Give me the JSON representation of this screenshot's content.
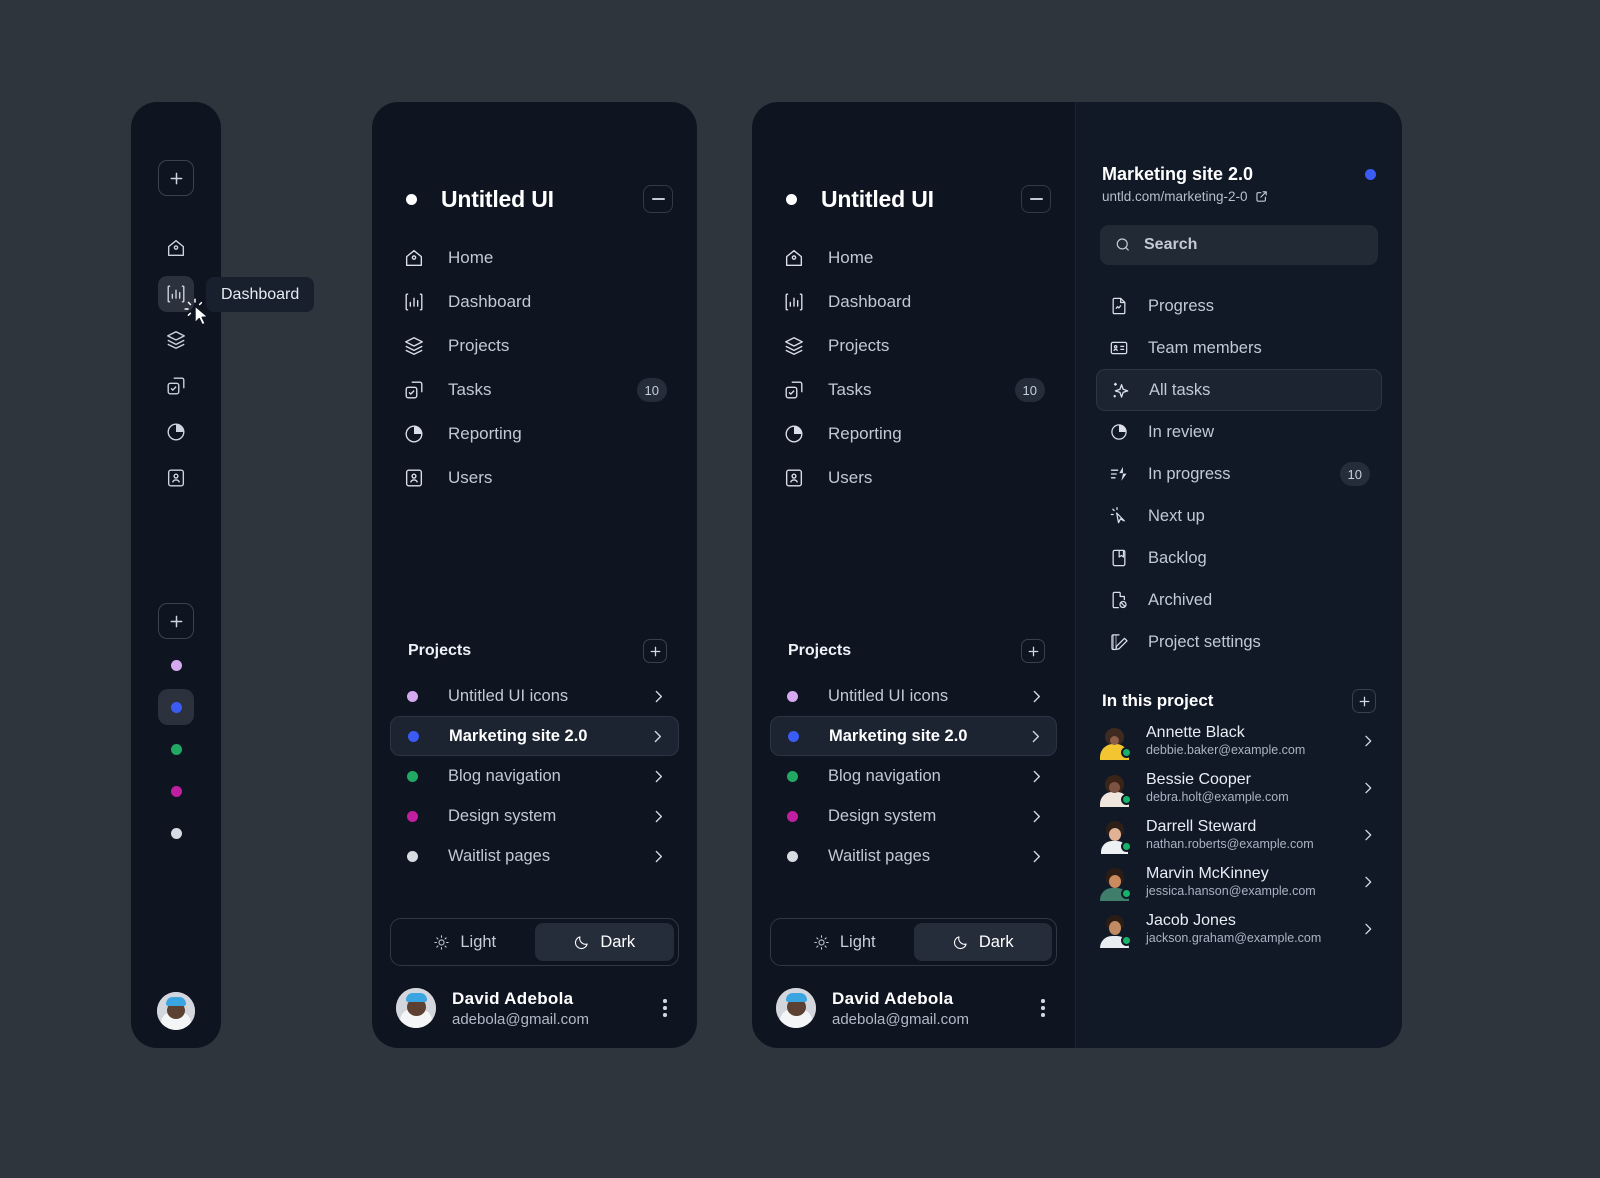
{
  "app": {
    "brand_name": "Untitled UI",
    "brand_dot_color": "#ffffff",
    "page_bg": "#2f353d",
    "panel_bg": "#0e1521"
  },
  "tooltip": {
    "label": "Dashboard"
  },
  "rail": {
    "add_icon": "plus-icon",
    "icons": [
      {
        "name": "home-icon",
        "active": false
      },
      {
        "name": "dashboard-icon",
        "active": true
      },
      {
        "name": "layers-icon",
        "active": false
      },
      {
        "name": "tasks-icon",
        "active": false
      },
      {
        "name": "pie-chart-icon",
        "active": false
      },
      {
        "name": "users-icon",
        "active": false
      }
    ],
    "project_dots": [
      {
        "name": "untitled-ui-icons",
        "color": "#d6a8f0",
        "active": false
      },
      {
        "name": "marketing-site-2-0",
        "color": "#3b5bf5",
        "active": true
      },
      {
        "name": "blog-navigation",
        "color": "#21a862",
        "active": false
      },
      {
        "name": "design-system",
        "color": "#c01fa0",
        "active": false
      },
      {
        "name": "waitlist-pages",
        "color": "#d7dbe2",
        "active": false
      }
    ]
  },
  "nav": {
    "items": [
      {
        "label": "Home",
        "icon": "home-icon",
        "badge": ""
      },
      {
        "label": "Dashboard",
        "icon": "dashboard-icon",
        "badge": ""
      },
      {
        "label": "Projects",
        "icon": "layers-icon",
        "badge": ""
      },
      {
        "label": "Tasks",
        "icon": "tasks-icon",
        "badge": "10"
      },
      {
        "label": "Reporting",
        "icon": "pie-chart-icon",
        "badge": ""
      },
      {
        "label": "Users",
        "icon": "users-icon",
        "badge": ""
      }
    ]
  },
  "projects": {
    "title": "Projects",
    "add_label": "+",
    "items": [
      {
        "label": "Untitled UI icons",
        "color": "#d6a8f0",
        "active": false
      },
      {
        "label": "Marketing site 2.0",
        "color": "#3b5bf5",
        "active": true
      },
      {
        "label": "Blog navigation",
        "color": "#21a862",
        "active": false
      },
      {
        "label": "Design system",
        "color": "#c01fa0",
        "active": false
      },
      {
        "label": "Waitlist pages",
        "color": "#d7dbe2",
        "active": false
      }
    ]
  },
  "theme": {
    "light_label": "Light",
    "dark_label": "Dark",
    "selected": "Dark"
  },
  "user": {
    "name": "David  Adebola",
    "email": "adebola@gmail.com"
  },
  "detail": {
    "project_title": "Marketing site 2.0",
    "project_url": "untld.com/marketing-2-0",
    "status_dot_color": "#3b5bf5",
    "search_placeholder": "Search",
    "items": [
      {
        "label": "Progress",
        "icon": "document-chart-icon",
        "badge": "",
        "active": false
      },
      {
        "label": "Team members",
        "icon": "id-card-icon",
        "badge": "",
        "active": false
      },
      {
        "label": "All tasks",
        "icon": "sparkles-icon",
        "badge": "",
        "active": true
      },
      {
        "label": "In review",
        "icon": "pie-chart-icon",
        "badge": "",
        "active": false
      },
      {
        "label": "In progress",
        "icon": "lightning-lines-icon",
        "badge": "10",
        "active": false
      },
      {
        "label": "Next up",
        "icon": "cursor-click-icon",
        "badge": "",
        "active": false
      },
      {
        "label": "Backlog",
        "icon": "bookmark-list-icon",
        "badge": "",
        "active": false
      },
      {
        "label": "Archived",
        "icon": "file-archived-icon",
        "badge": "",
        "active": false
      },
      {
        "label": "Project settings",
        "icon": "edit-grid-icon",
        "badge": "",
        "active": false
      }
    ],
    "members_title": "In this project",
    "members": [
      {
        "name": "Annette Black",
        "email": "debbie.baker@example.com",
        "avatar_bg": "#d9789f",
        "status": "online"
      },
      {
        "name": "Bessie Cooper",
        "email": "debra.holt@example.com",
        "avatar_bg": "#f5c344",
        "status": "online"
      },
      {
        "name": "Darrell Steward",
        "email": "nathan.roberts@example.com",
        "avatar_bg": "#8fd0e8",
        "status": "online"
      },
      {
        "name": "Marvin McKinney",
        "email": "jessica.hanson@example.com",
        "avatar_bg": "#f2b13c",
        "status": "online"
      },
      {
        "name": "Jacob Jones",
        "email": "jackson.graham@example.com",
        "avatar_bg": "#d8c2aa",
        "status": "online"
      }
    ]
  }
}
